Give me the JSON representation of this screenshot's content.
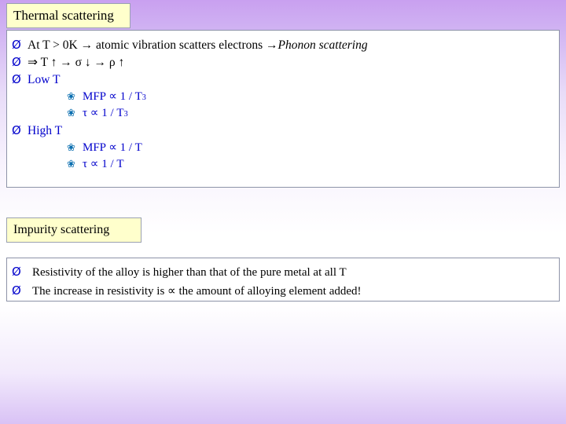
{
  "slide": {
    "thermal": {
      "title": "Thermal scattering",
      "lines": [
        {
          "bullet": "Ø",
          "indent": 1,
          "segments": [
            {
              "text": "At  T > 0K  → atomic vibration scatters electrons → ",
              "style": "plain"
            },
            {
              "text": "Phonon scattering",
              "style": "italic"
            }
          ]
        },
        {
          "bullet": "Ø",
          "indent": 1,
          "segments": [
            {
              "text": "⇒  T ↑ → σ ↓ → ρ ↑",
              "style": "plain"
            }
          ]
        },
        {
          "bullet": "Ø",
          "indent": 1,
          "segments": [
            {
              "text": "Low T",
              "style": "blue"
            }
          ]
        },
        {
          "bullet": "❀",
          "indent": 2,
          "segments": [
            {
              "text": "MFP  ∝ 1 / T",
              "style": "blue"
            },
            {
              "text": "3",
              "style": "blue-sup"
            }
          ]
        },
        {
          "bullet": "❀",
          "indent": 2,
          "segments": [
            {
              "text": "τ  ∝ 1 / T",
              "style": "blue"
            },
            {
              "text": "3",
              "style": "blue-sup"
            }
          ]
        },
        {
          "bullet": "Ø",
          "indent": 1,
          "segments": [
            {
              "text": "High T",
              "style": "blue"
            }
          ]
        },
        {
          "bullet": "❀",
          "indent": 2,
          "segments": [
            {
              "text": "MFP  ∝ 1 / T",
              "style": "blue"
            }
          ]
        },
        {
          "bullet": "❀",
          "indent": 2,
          "segments": [
            {
              "text": "τ  ∝ 1 / T",
              "style": "blue"
            }
          ]
        }
      ]
    },
    "impurity": {
      "title": "Impurity scattering",
      "lines": [
        {
          "bullet": "Ø",
          "text": "Resistivity of the alloy is higher than that of the pure metal at all T"
        },
        {
          "bullet": "Ø",
          "text": "The increase in resistivity is ∝ the amount of alloying element added!"
        }
      ]
    }
  },
  "colors": {
    "title_fill": "#ffffcc",
    "box_border": "#8d93a8",
    "blue_text": "#0000cc",
    "sub_bullet": "#0b6fb0",
    "background_top": "#c9a0f0",
    "background_mid": "#ffffff"
  }
}
